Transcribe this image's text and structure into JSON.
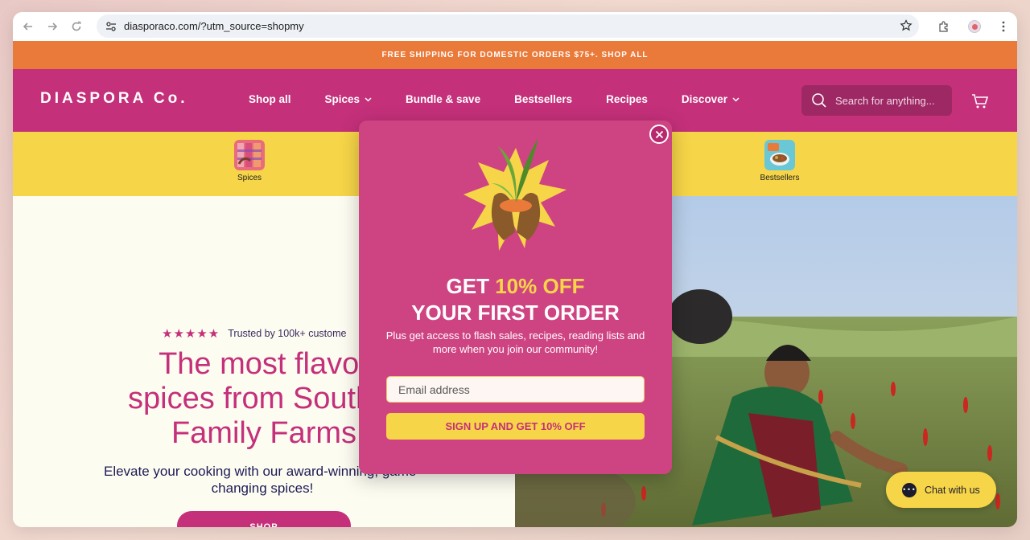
{
  "browser": {
    "url": "diasporaco.com/?utm_source=shopmy"
  },
  "promo_bar": {
    "text": "FREE SHIPPING FOR DOMESTIC ORDERS $75+. SHOP ALL"
  },
  "header": {
    "logo": "DIASPORA Co.",
    "nav": [
      {
        "label": "Shop all",
        "dropdown": false
      },
      {
        "label": "Spices",
        "dropdown": true
      },
      {
        "label": "Bundle & save",
        "dropdown": false
      },
      {
        "label": "Bestsellers",
        "dropdown": false
      },
      {
        "label": "Recipes",
        "dropdown": false
      },
      {
        "label": "Discover",
        "dropdown": true
      }
    ],
    "search_placeholder": "Search for anything..."
  },
  "categories": [
    {
      "label": "Spices"
    },
    {
      "label": "Bestsellers"
    }
  ],
  "hero": {
    "stars": "★★★★★",
    "trust": "Trusted by 100k+ custome",
    "title_lines": [
      "The most flavor",
      "spices from South A",
      "Family Farms"
    ],
    "subtitle": "Elevate your cooking with our award-winning, game-changing spices!",
    "cta": "SHOP"
  },
  "popup": {
    "headline_pre": "GET ",
    "headline_accent": "10% OFF",
    "headline_line2": "YOUR FIRST ORDER",
    "body": "Plus get access to flash sales, recipes, reading lists and more when you join our community!",
    "email_placeholder": "Email address",
    "button": "SIGN UP AND GET 10% OFF"
  },
  "chat": {
    "label": "Chat with us"
  },
  "colors": {
    "brand_pink": "#c4307a",
    "popup_pink": "#ce4482",
    "yellow": "#f7d548",
    "orange": "#ea7a3a",
    "navy": "#1d1b56"
  }
}
